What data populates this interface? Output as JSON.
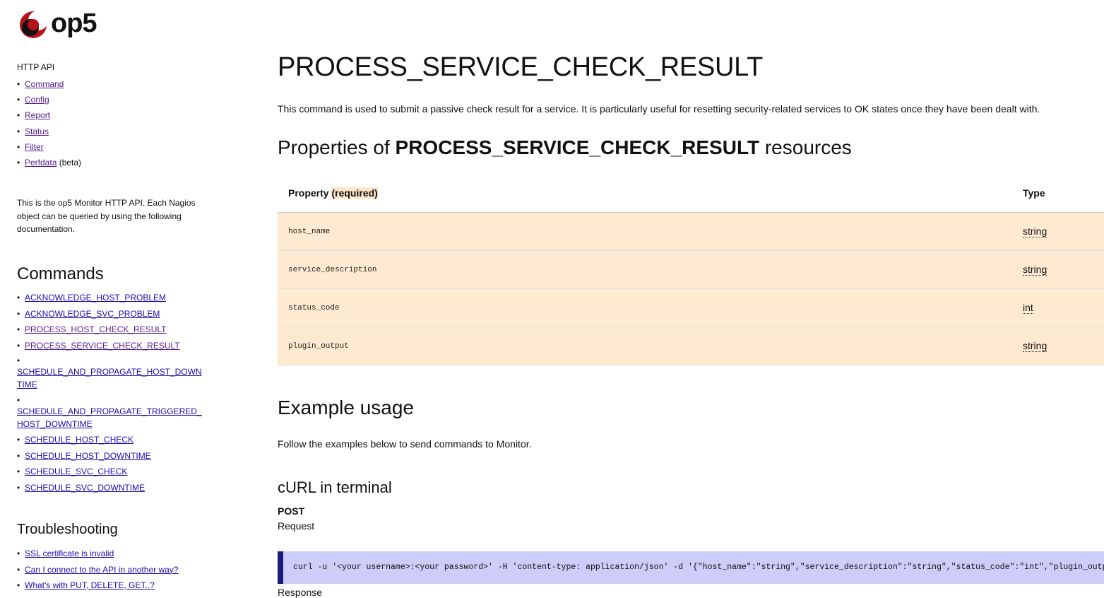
{
  "logo": {
    "text": "op5"
  },
  "sidebar": {
    "heading": "HTTP API",
    "api_links": [
      {
        "label": "Command",
        "suffix": ""
      },
      {
        "label": "Config",
        "suffix": ""
      },
      {
        "label": "Report",
        "suffix": ""
      },
      {
        "label": "Status",
        "suffix": ""
      },
      {
        "label": "Filter",
        "suffix": ""
      },
      {
        "label": "Perfdata",
        "suffix": " (beta)"
      }
    ],
    "description": "This is the op5 Monitor HTTP API. Each Nagios object can be queried by using the following documentation.",
    "commands_heading": "Commands",
    "commands": [
      "ACKNOWLEDGE_HOST_PROBLEM",
      "ACKNOWLEDGE_SVC_PROBLEM",
      "PROCESS_HOST_CHECK_RESULT",
      "PROCESS_SERVICE_CHECK_RESULT",
      "SCHEDULE_AND_PROPAGATE_HOST_DOWNTIME",
      "SCHEDULE_AND_PROPAGATE_TRIGGERED_HOST_DOWNTIME",
      "SCHEDULE_HOST_CHECK",
      "SCHEDULE_HOST_DOWNTIME",
      "SCHEDULE_SVC_CHECK",
      "SCHEDULE_SVC_DOWNTIME"
    ],
    "troubleshooting_heading": "Troubleshooting",
    "troubleshooting": [
      "SSL certificate is invalid",
      "Can I connect to the API in another way?",
      "What's with PUT, DELETE, GET..?"
    ]
  },
  "main": {
    "title": "PROCESS_SERVICE_CHECK_RESULT",
    "intro": "This command is used to submit a passive check result for a service. It is particularly useful for resetting security-related services to OK states once they have been dealt with.",
    "props_heading_prefix": "Properties of ",
    "props_heading_bold": "PROCESS_SERVICE_CHECK_RESULT",
    "props_heading_suffix": " resources",
    "table": {
      "col_property": "Property ",
      "col_required": "(required)",
      "col_type": "Type",
      "rows": [
        {
          "name": "host_name",
          "type": "string"
        },
        {
          "name": "service_description",
          "type": "string"
        },
        {
          "name": "status_code",
          "type": "int"
        },
        {
          "name": "plugin_output",
          "type": "string"
        }
      ]
    },
    "example_heading": "Example usage",
    "example_text": "Follow the examples below to send commands to Monitor.",
    "curl_heading": "cURL in terminal",
    "post_label": "POST",
    "request_label": "Request",
    "curl_command": "curl -u '<your username>:<your password>' -H 'content-type: application/json' -d '{\"host_name\":\"string\",\"service_description\":\"string\",\"status_code\":\"int\",\"plugin_output\":\"string\"}'",
    "response_label": "Response"
  },
  "colors": {
    "table_row_bg": "#feead0",
    "code_bg": "#cdcdfa",
    "code_border": "#1c1c7a",
    "link": "#1a0dab",
    "visited_link": "#551a8b",
    "logo_red": "#b5121b"
  }
}
